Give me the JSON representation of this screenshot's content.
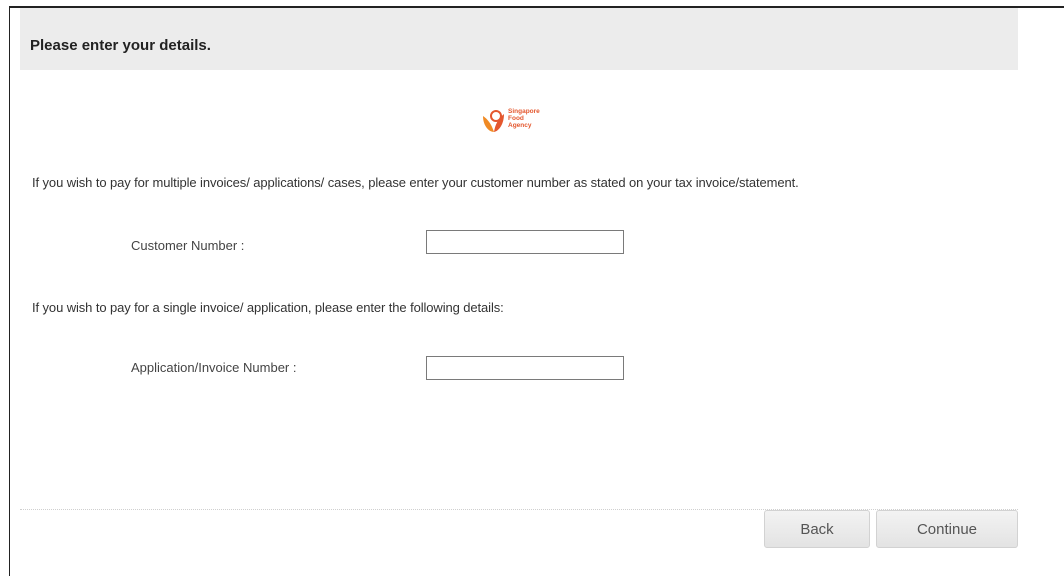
{
  "header": {
    "title": "Please enter your details."
  },
  "logo": {
    "lines": [
      "Singapore",
      "Food",
      "Agency"
    ],
    "icon": "leaf-icon",
    "brand_color": "#e4572e"
  },
  "instructions": {
    "multiple": "If you wish to pay for multiple invoices/ applications/ cases, please enter your customer number as stated on your tax invoice/statement.",
    "single": "If you wish to pay for a single invoice/ application, please enter the following details:"
  },
  "fields": {
    "customer_number": {
      "label": "Customer Number :",
      "value": ""
    },
    "application_number": {
      "label": "Application/Invoice Number :",
      "value": ""
    }
  },
  "buttons": {
    "back": "Back",
    "continue": "Continue"
  }
}
